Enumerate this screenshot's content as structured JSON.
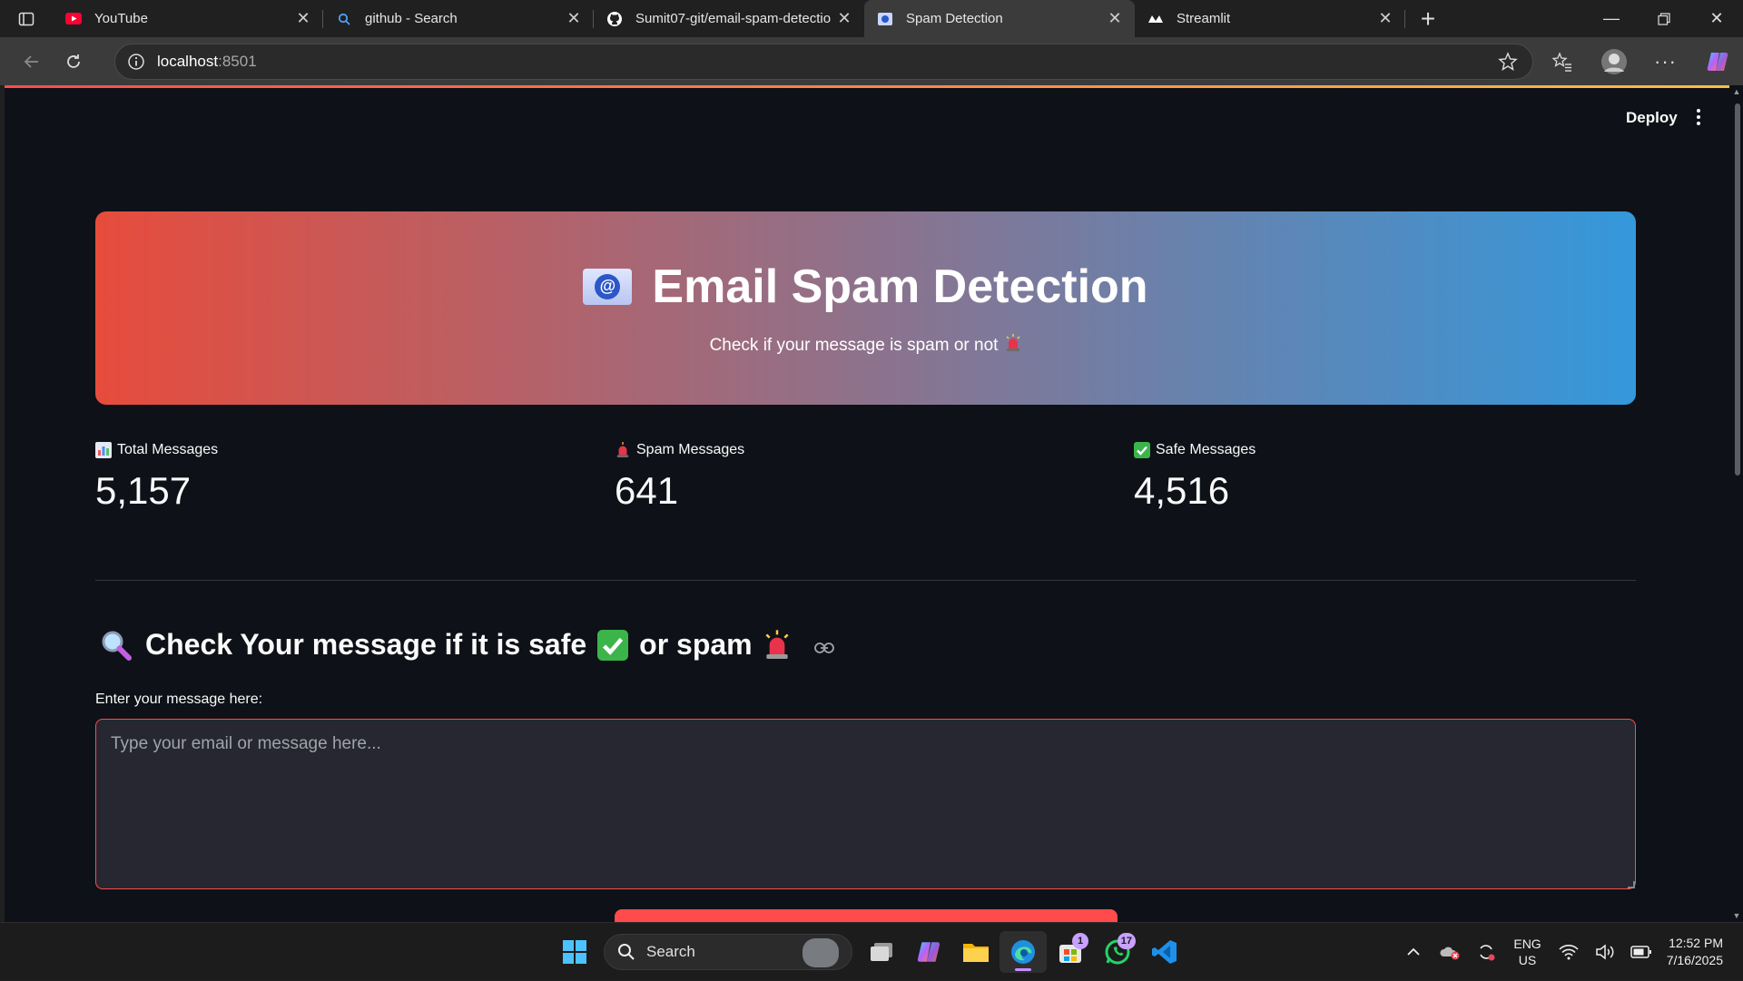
{
  "browser": {
    "tabs": [
      {
        "title": "YouTube",
        "favicon": "youtube-icon",
        "color": "#ff0033"
      },
      {
        "title": "github - Search",
        "favicon": "search-icon",
        "color": "#4aa3ff"
      },
      {
        "title": "Sumit07-git/email-spam-detectio",
        "favicon": "github-icon",
        "color": "#ffffff"
      },
      {
        "title": "Spam Detection",
        "favicon": "page-icon",
        "color": "#8ab4f8"
      },
      {
        "title": "Streamlit",
        "favicon": "streamlit-icon",
        "color": "#ffffff"
      }
    ],
    "active_tab_index": 3,
    "url_host": "localhost",
    "url_port": ":8501"
  },
  "app": {
    "deploy_label": "Deploy",
    "hero": {
      "title": "Email Spam Detection",
      "subtitle": "Check if your message is spam or not",
      "gradient": [
        "#e74c3c",
        "#3498db"
      ]
    },
    "metrics": [
      {
        "label": "Total Messages",
        "value": "5,157",
        "icon": "bar-chart-icon"
      },
      {
        "label": "Spam Messages",
        "value": "641",
        "icon": "siren-icon"
      },
      {
        "label": "Safe Messages",
        "value": "4,516",
        "icon": "check-box-icon"
      }
    ],
    "section": {
      "part1": "Check Your message if it is safe",
      "part2": "or spam"
    },
    "input": {
      "label": "Enter your message here:",
      "placeholder": "Type your email or message here..."
    },
    "accent_color": "#ff4b4b"
  },
  "taskbar": {
    "search_label": "Search",
    "store_badge": "1",
    "whatsapp_badge": "17",
    "language_line1": "ENG",
    "language_line2": "US",
    "time": "12:52 PM",
    "date": "7/16/2025"
  }
}
